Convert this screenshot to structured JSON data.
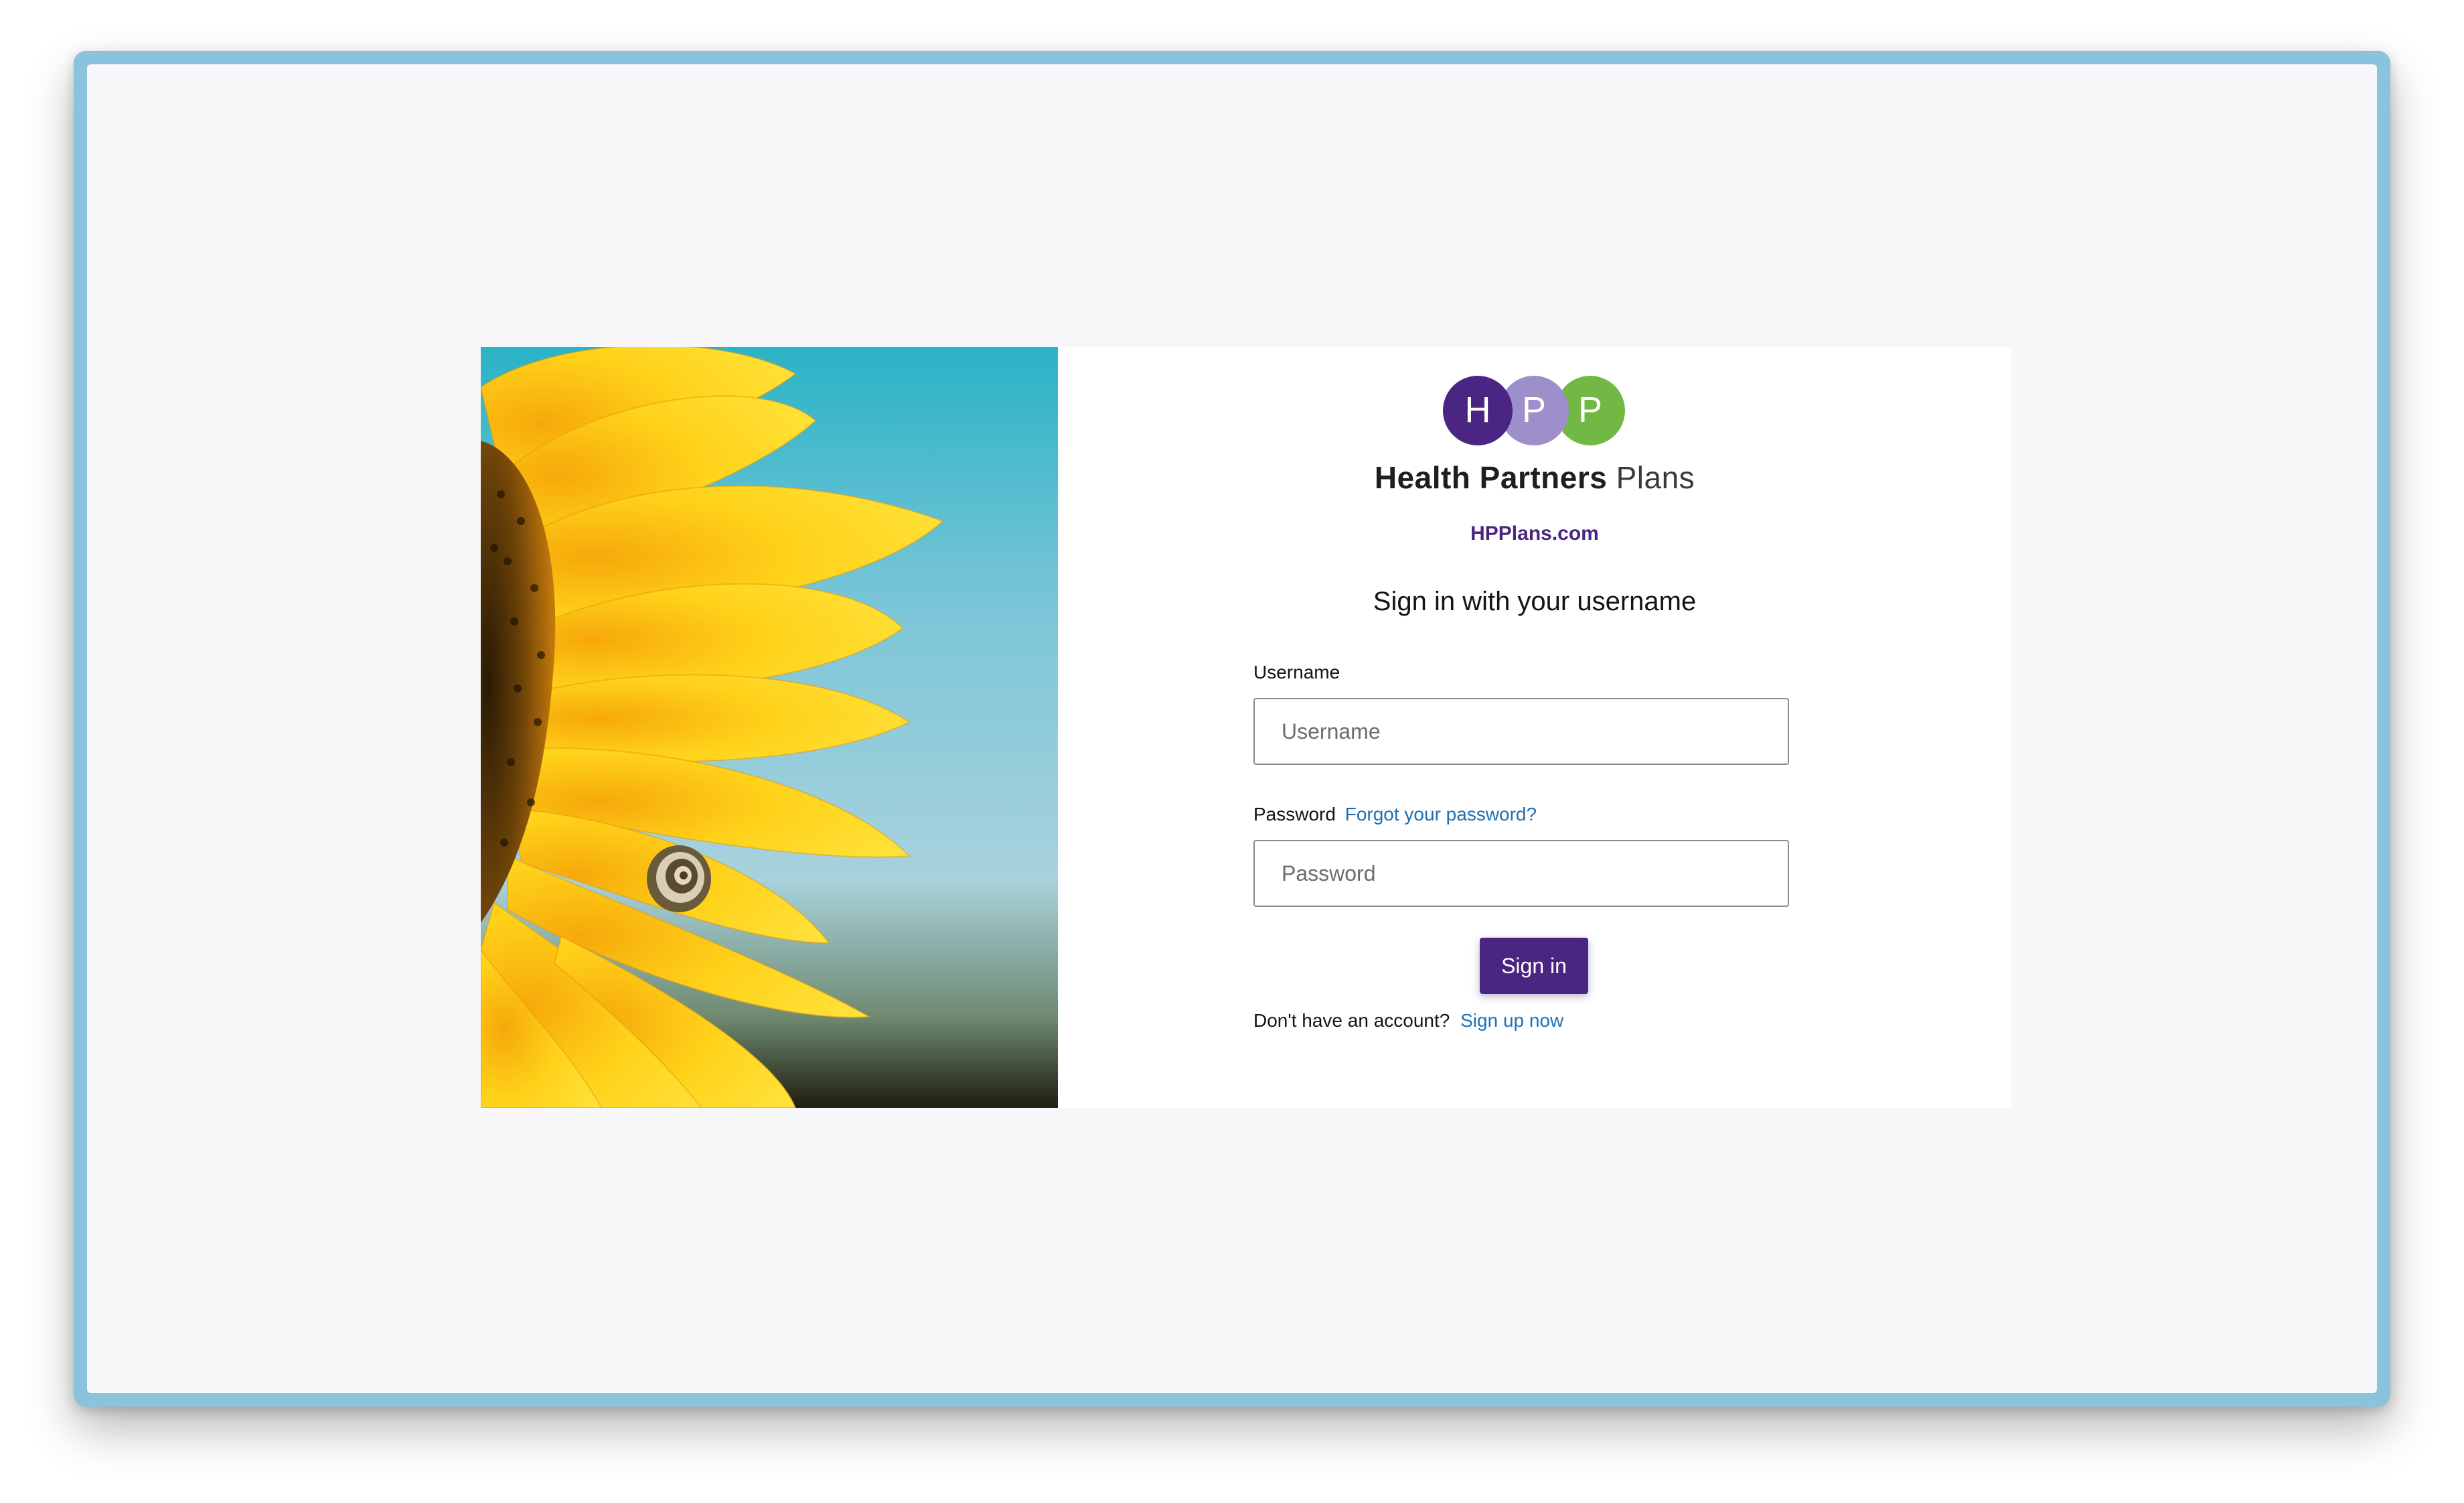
{
  "brand": {
    "logo_letters": [
      "H",
      "P",
      "P"
    ],
    "logo_colors": [
      "#4a2581",
      "#9d8fc9",
      "#72b844"
    ],
    "name_bold": "Health Partners",
    "name_light": "Plans",
    "site": "HPPlans.com"
  },
  "form": {
    "heading": "Sign in with your username",
    "username_label": "Username",
    "username_placeholder": "Username",
    "username_value": "",
    "password_label": "Password",
    "forgot_link": "Forgot your password?",
    "password_placeholder": "Password",
    "password_value": "",
    "submit_label": "Sign in",
    "signup_prompt": "Don't have an account?",
    "signup_link": "Sign up now"
  },
  "colors": {
    "accent": "#4a2581",
    "link": "#1f6fb2",
    "frame": "#8cc3dc",
    "page_background": "#f7f7fa"
  },
  "hero": {
    "icon": "sunflower-image"
  }
}
